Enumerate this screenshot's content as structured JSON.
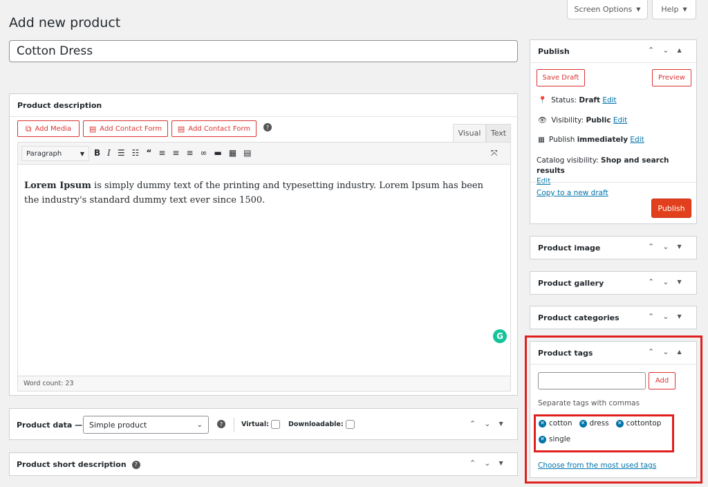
{
  "header": {
    "screen_options": "Screen Options",
    "help": "Help",
    "page_title": "Add new product"
  },
  "product_title": "Cotton Dress",
  "description": {
    "heading": "Product description",
    "add_media": "Add Media",
    "add_contact_form_1": "Add Contact Form",
    "add_contact_form_2": "Add Contact Form",
    "tab_visual": "Visual",
    "tab_text": "Text",
    "format_select": "Paragraph",
    "body_bold": "Lorem Ipsum",
    "body_rest": " is simply dummy text of the printing and typesetting industry. Lorem Ipsum has been the industry's standard dummy text ever since 1500.",
    "word_count": "Word count: 23"
  },
  "product_data": {
    "label": "Product data —",
    "type_value": "Simple product",
    "virtual_label": "Virtual:",
    "downloadable_label": "Downloadable:"
  },
  "short_description": {
    "heading": "Product short description"
  },
  "publish": {
    "heading": "Publish",
    "save_draft": "Save Draft",
    "preview": "Preview",
    "status_label": "Status: ",
    "status_value": "Draft",
    "visibility_label": "Visibility: ",
    "visibility_value": "Public",
    "publish_label": "Publish ",
    "publish_value": "immediately",
    "edit": "Edit",
    "catalog_label": "Catalog visibility: ",
    "catalog_value": "Shop and search results",
    "copy_draft": "Copy to a new draft",
    "publish_button": "Publish"
  },
  "sidebar_boxes": {
    "product_image": "Product image",
    "product_gallery": "Product gallery",
    "product_categories": "Product categories"
  },
  "product_tags": {
    "heading": "Product tags",
    "input_value": "",
    "add_button": "Add",
    "hint": "Separate tags with commas",
    "tags": [
      "cotton",
      "dress",
      "cottontop",
      "single"
    ],
    "choose_link": "Choose from the most used tags"
  },
  "colors": {
    "accent": "#0073aa",
    "danger": "#dc3232",
    "publish": "#e2401c",
    "highlight": "#e0201c"
  }
}
